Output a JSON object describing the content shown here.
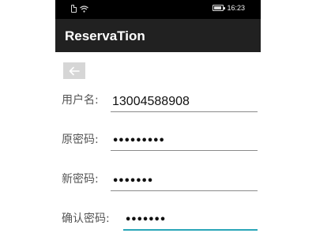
{
  "status_bar": {
    "time": "16:23",
    "icons": [
      "sim-icon",
      "wifi-icon",
      "battery-icon"
    ]
  },
  "app_bar": {
    "title": "ReservaTion"
  },
  "back_button": {
    "icon": "arrow-left-icon"
  },
  "form": {
    "username": {
      "label": "用户名:",
      "value": "13004588908"
    },
    "old_password": {
      "label": "原密码:",
      "value": "•••••••••"
    },
    "new_password": {
      "label": "新密码:",
      "value": "•••••••"
    },
    "confirm_password": {
      "label": "确认密码:",
      "value": "•••••••"
    }
  },
  "colors": {
    "status_bar": "#000000",
    "app_bar": "#212121",
    "focus_underline": "#2aa6b8",
    "back_button": "#d6d6d6"
  }
}
